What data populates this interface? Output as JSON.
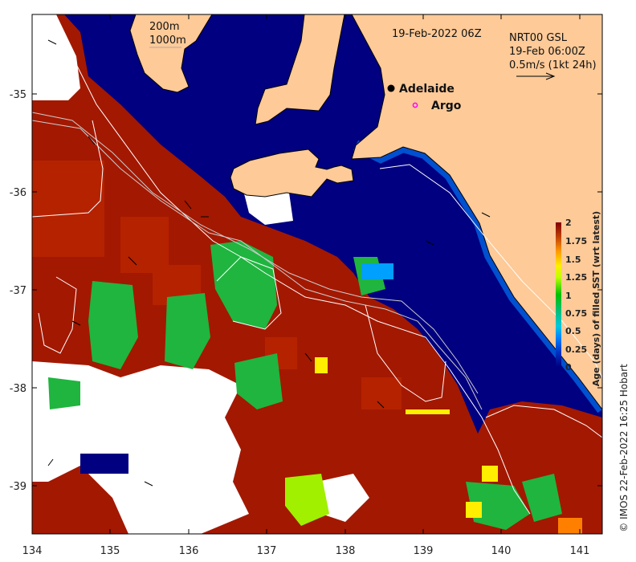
{
  "map": {
    "date_label": "19-Feb-2022 06Z",
    "legend_contours": [
      "200m",
      "1000m"
    ],
    "current_legend": [
      "NRT00 GSL",
      "19-Feb 06:00Z",
      "0.5m/s (1kt 24h)"
    ],
    "places": [
      {
        "name": "Adelaide",
        "symbol": "filled-circle",
        "color": "#000000"
      },
      {
        "name": "Argo",
        "symbol": "open-circle",
        "color": "#ff00ff"
      }
    ],
    "x_ticks": [
      "134",
      "135",
      "136",
      "137",
      "138",
      "139",
      "140",
      "141"
    ],
    "y_ticks": [
      "-35",
      "-36",
      "-37",
      "-38",
      "-39"
    ],
    "land_color": "#fdca98",
    "ocean_old_color": "#a31800",
    "ocean_new_color": "#000080"
  },
  "colorbar": {
    "title": "Age (days) of filled SST (wrt latest)",
    "ticks": [
      "2",
      "1.75",
      "1.5",
      "1.25",
      "1",
      "0.75",
      "0.5",
      "0.25",
      "0"
    ],
    "range": [
      0,
      2
    ]
  },
  "credit": "© IMOS 22-Feb-2022 16:25 Hobart"
}
